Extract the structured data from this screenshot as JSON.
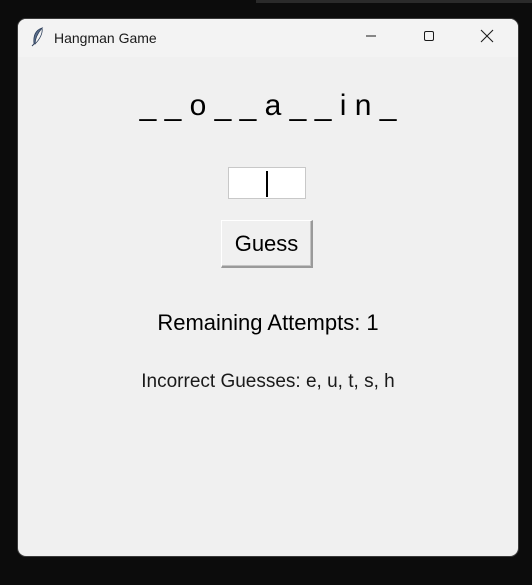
{
  "window": {
    "title": "Hangman Game",
    "icon": "feather-icon",
    "controls": [
      "minimize-icon",
      "maximize-icon",
      "close-icon"
    ]
  },
  "game": {
    "word_display": "_ _ o _ _ a _ _ i n _",
    "guess_input_value": "",
    "guess_button_label": "Guess",
    "remaining_attempts_text": "Remaining Attempts: 1",
    "incorrect_guesses_text": "Incorrect Guesses: e, u, t, s, h"
  },
  "colors": {
    "window_bg": "#f0f0f0",
    "desktop_bg": "#0c0c0c",
    "text": "#000000"
  }
}
